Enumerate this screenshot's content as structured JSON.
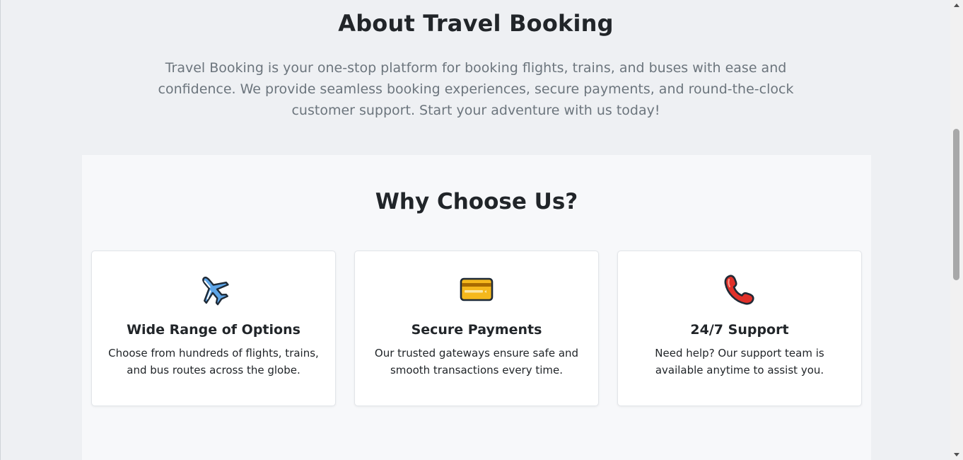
{
  "about": {
    "title": "About Travel Booking",
    "text": "Travel Booking is your one-stop platform for booking flights, trains, and buses with ease and confidence. We provide seamless booking experiences, secure payments, and round-the-clock customer support. Start your adventure with us today!"
  },
  "why": {
    "title": "Why Choose Us?",
    "cards": [
      {
        "icon": "airplane-icon",
        "title": "Wide Range of Options",
        "text": "Choose from hundreds of flights, trains, and bus routes across the globe."
      },
      {
        "icon": "credit-card-icon",
        "title": "Secure Payments",
        "text": "Our trusted gateways ensure safe and smooth transactions every time."
      },
      {
        "icon": "telephone-icon",
        "title": "24/7 Support",
        "text": "Need help? Our support team is available anytime to assist you."
      }
    ]
  },
  "scrollbar": {
    "position": 0.28
  },
  "colors": {
    "page_bg": "#eef0f3",
    "section_bg": "#f7f8fa",
    "heading": "#212529",
    "muted_text": "#6c757d"
  }
}
